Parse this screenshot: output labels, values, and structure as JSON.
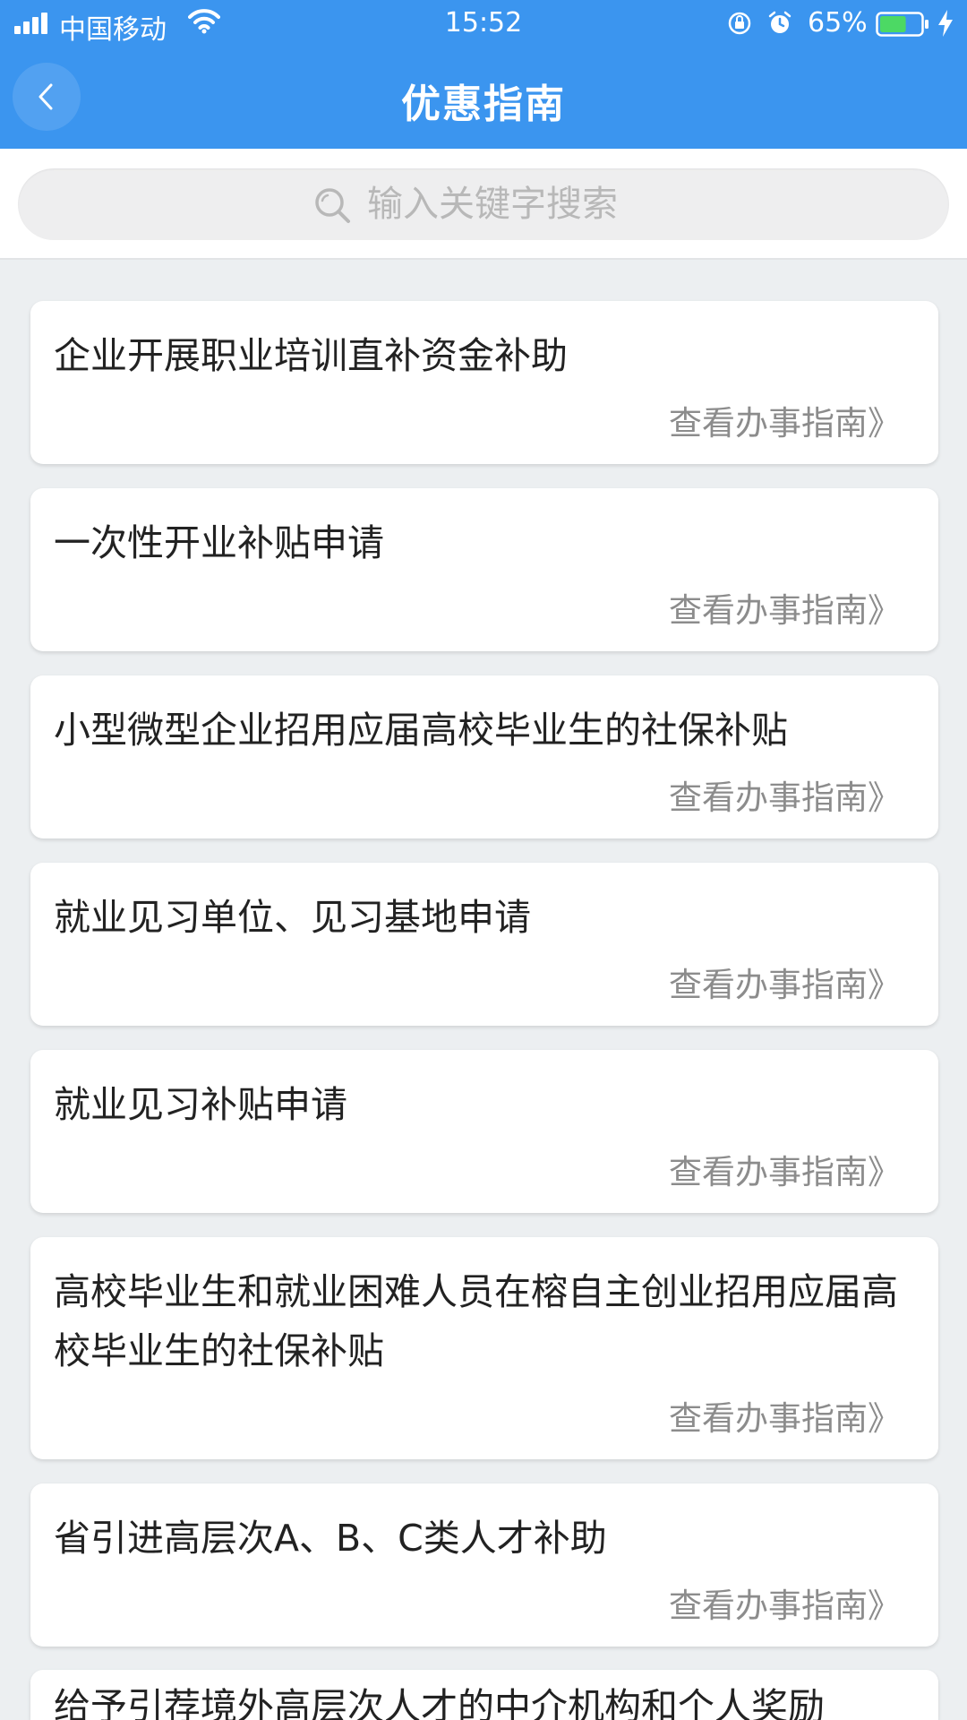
{
  "status_bar": {
    "carrier": "中国移动",
    "time": "15:52",
    "battery_percent": "65%",
    "battery_level": 0.65
  },
  "nav": {
    "title": "优惠指南",
    "back_icon": "chevron-left-icon"
  },
  "search": {
    "placeholder": "输入关键字搜索",
    "value": ""
  },
  "colors": {
    "primary": "#3b95ef",
    "background": "#eceff1",
    "link_gray": "#8c8c8c",
    "battery_green": "#4cd964"
  },
  "list": {
    "link_label": "查看办事指南》",
    "items": [
      {
        "title": "企业开展职业培训直补资金补助"
      },
      {
        "title": "一次性开业补贴申请"
      },
      {
        "title": "小型微型企业招用应届高校毕业生的社保补贴"
      },
      {
        "title": "就业见习单位、见习基地申请"
      },
      {
        "title": "就业见习补贴申请"
      },
      {
        "title": "高校毕业生和就业困难人员在榕自主创业招用应届高校毕业生的社保补贴"
      },
      {
        "title": "省引进高层次A、B、C类人才补助"
      },
      {
        "title": "给予引荐境外高层次人才的中介机构和个人奖励"
      }
    ]
  }
}
